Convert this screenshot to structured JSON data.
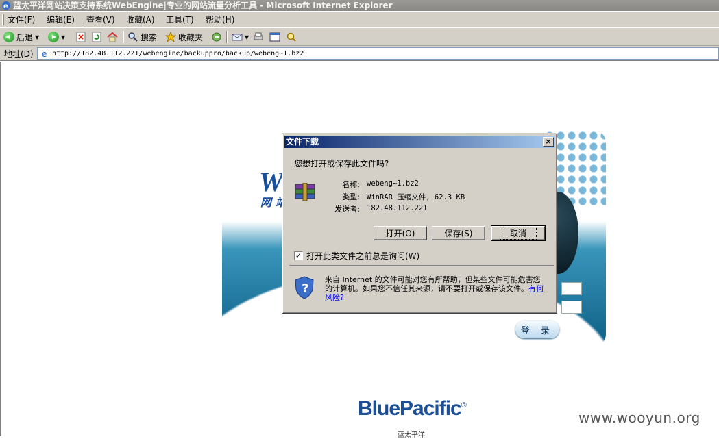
{
  "window": {
    "title": "蓝太平洋网站决策支持系统WebEngine|专业的网站流量分析工具 - Microsoft Internet Explorer"
  },
  "menu": {
    "items": [
      "文件(F)",
      "编辑(E)",
      "查看(V)",
      "收藏(A)",
      "工具(T)",
      "帮助(H)"
    ]
  },
  "toolbar": {
    "back_label": "后退",
    "search_label": "搜索",
    "favorites_label": "收藏夹"
  },
  "address": {
    "label": "地址(D)",
    "url": "http://182.48.112.221/webengine/backuppro/backup/webeng~1.bz2"
  },
  "login_panel": {
    "brand_fragment": "We",
    "brand_cn_fragment": "网 站",
    "login_button": "登 录"
  },
  "footer": {
    "logo_text": "BluePacific",
    "logo_mark": "®",
    "logo_sub": "蓝太平洋",
    "watermark": "www.wooyun.org"
  },
  "dialog": {
    "title": "文件下载",
    "close_glyph": "×",
    "question": "您想打开或保存此文件吗?",
    "fields": [
      {
        "label": "名称:",
        "value": "webeng~1.bz2"
      },
      {
        "label": "类型:",
        "value": "WinRAR 压缩文件, 62.3 KB"
      },
      {
        "label": "发送者:",
        "value": "182.48.112.221"
      }
    ],
    "buttons": {
      "open": "打开(O)",
      "save": "保存(S)",
      "cancel": "取消"
    },
    "checkbox": {
      "label": "打开此类文件之前总是询问(W)",
      "checked": true,
      "mark": "✓"
    },
    "warning": {
      "text": "来自 Internet 的文件可能对您有所帮助，但某些文件可能危害您的计算机。如果您不信任其来源，请不要打开或保存该文件。",
      "link": "有何风险?"
    }
  }
}
